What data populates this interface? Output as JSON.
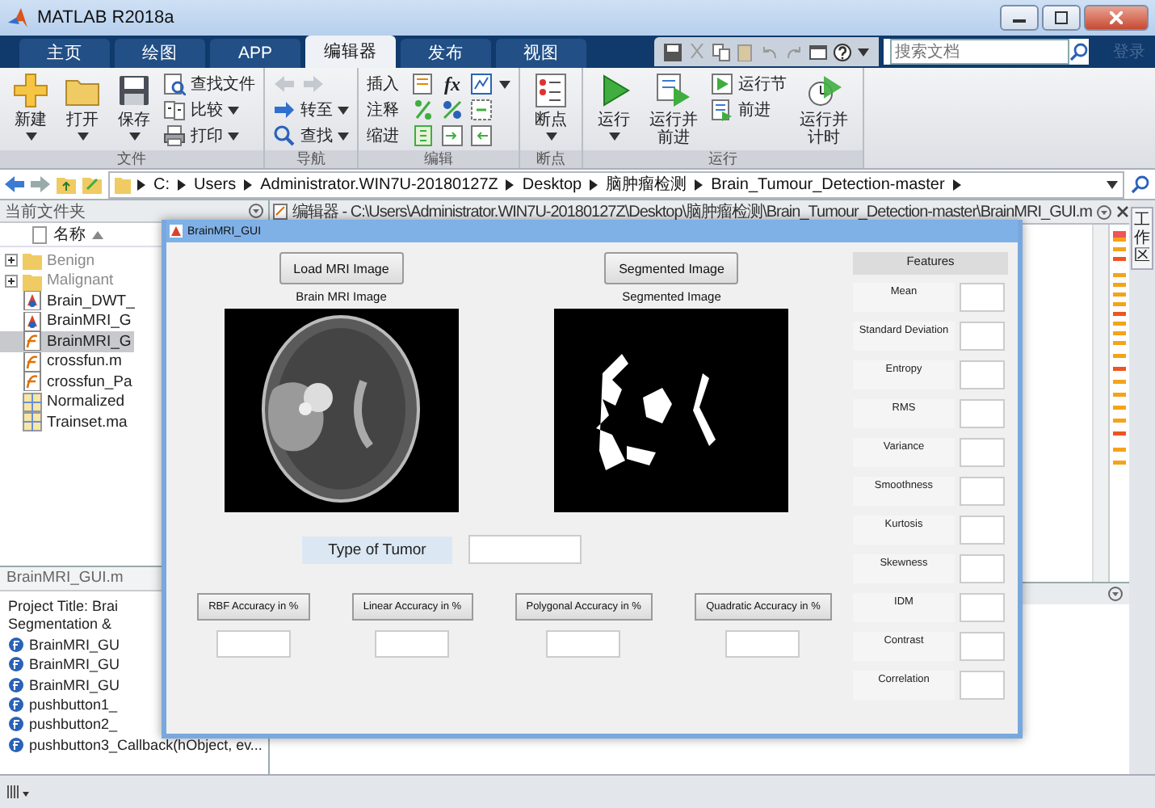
{
  "window": {
    "title": "MATLAB R2018a"
  },
  "tabs": [
    {
      "label": "主页",
      "selected": false
    },
    {
      "label": "绘图",
      "selected": false
    },
    {
      "label": "APP",
      "selected": false
    },
    {
      "label": "编辑器",
      "selected": true
    },
    {
      "label": "发布",
      "selected": false
    },
    {
      "label": "视图",
      "selected": false
    }
  ],
  "search": {
    "placeholder": "搜索文档"
  },
  "login": "登录",
  "ribbon": {
    "groups": [
      {
        "kind": "file",
        "title": "文件",
        "large": [
          "新建",
          "打开",
          "保存"
        ],
        "small": [
          "查找文件",
          "比较",
          "打印"
        ]
      },
      {
        "kind": "navigate",
        "title": "导航",
        "small": [
          "转至",
          "查找"
        ]
      },
      {
        "kind": "edit",
        "title": "编辑",
        "rows": [
          "插入",
          "注释",
          "缩进"
        ],
        "symbol": "fx"
      },
      {
        "kind": "breakpoints",
        "title": "断点",
        "large": [
          "断点"
        ]
      },
      {
        "kind": "run",
        "title": "运行",
        "large": [
          "运行",
          "运行并前进"
        ],
        "small": [
          "运行节",
          "前进"
        ],
        "large_end": [
          "运行并计时"
        ]
      }
    ]
  },
  "address": [
    "C:",
    "Users",
    "Administrator.WIN7U-20180127Z",
    "Desktop",
    "脑肿瘤检测",
    "Brain_Tumour_Detection-master"
  ],
  "current_folder": {
    "title": "当前文件夹",
    "column": "名称",
    "files": [
      {
        "name": "Benign",
        "kind": "folder",
        "greyed": true,
        "selected": false
      },
      {
        "name": "Malignant",
        "kind": "folder",
        "greyed": true,
        "selected": false
      },
      {
        "name": "Brain_DWT_",
        "kind": "fig",
        "greyed": false,
        "selected": false
      },
      {
        "name": "BrainMRI_G",
        "kind": "fig",
        "greyed": false,
        "selected": false
      },
      {
        "name": "BrainMRI_G",
        "kind": "mfile",
        "greyed": false,
        "selected": true
      },
      {
        "name": "crossfun.m",
        "kind": "mfile",
        "greyed": false,
        "selected": false
      },
      {
        "name": "crossfun_Pa",
        "kind": "mfile",
        "greyed": false,
        "selected": false
      },
      {
        "name": "Normalized",
        "kind": "mat",
        "greyed": false,
        "selected": false
      },
      {
        "name": "Trainset.ma",
        "kind": "mat",
        "greyed": false,
        "selected": false
      }
    ]
  },
  "details": {
    "title": "BrainMRI_GUI.m",
    "description": [
      "Project Title: Brai",
      "Segmentation &"
    ],
    "functions": [
      "BrainMRI_GU",
      "BrainMRI_GU",
      "BrainMRI_GU",
      "pushbutton1_",
      "pushbutton2_",
      "pushbutton3_Callback(hObject, ev..."
    ]
  },
  "editor": {
    "title": "编辑器 - C:\\Users\\Administrator.WIN7U-20180127Z\\Desktop\\脑肿瘤检测\\Brain_Tumour_Detection-master\\BrainMRI_GUI.m"
  },
  "side_tab": "工作区",
  "gui": {
    "title": "BrainMRI_GUI",
    "images": [
      {
        "kind": "mri",
        "button": "Load MRI Image",
        "caption": "Brain MRI Image"
      },
      {
        "kind": "mask",
        "button": "Segmented Image",
        "caption": "Segmented Image"
      }
    ],
    "type_label": "Type of Tumor",
    "accuracy_buttons": [
      "RBF Accuracy in %",
      "Linear Accuracy in %",
      "Polygonal Accuracy in %",
      "Quadratic Accuracy in %"
    ],
    "features_title": "Features",
    "features": [
      "Mean",
      "Standard Deviation",
      "Entropy",
      "RMS",
      "Variance",
      "Smoothness",
      "Kurtosis",
      "Skewness",
      "IDM",
      "Contrast",
      "Correlation"
    ]
  }
}
